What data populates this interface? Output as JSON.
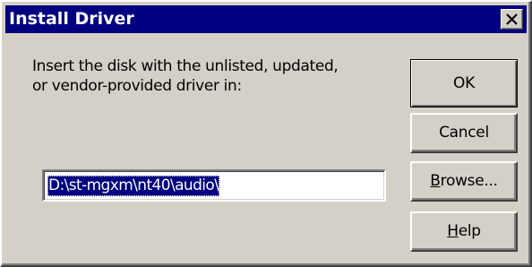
{
  "dialog": {
    "title": "Install Driver",
    "close_icon": "close-x-icon"
  },
  "message": {
    "line1": "Insert the disk with the unlisted, updated,",
    "line2": "or vendor-provided driver in:"
  },
  "path_field": {
    "value": "D:\\st-mgxm\\nt40\\audio\\"
  },
  "buttons": {
    "ok": "OK",
    "cancel": "Cancel",
    "browse_mnemonic": "B",
    "browse_rest": "rowse...",
    "help_mnemonic": "H",
    "help_rest": "elp"
  }
}
